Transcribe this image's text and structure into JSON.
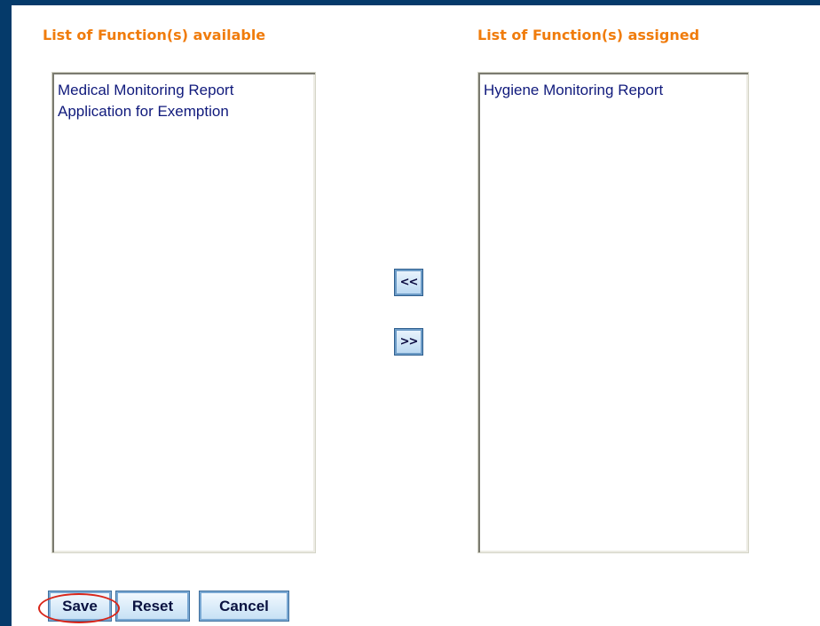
{
  "assignment": {
    "available_heading": "List of Function(s) available",
    "assigned_heading": "List of Function(s) assigned",
    "available_items": [
      "Medical Monitoring Report",
      "Application for Exemption"
    ],
    "assigned_items": [
      "Hygiene Monitoring Report"
    ],
    "remove_label": "<<",
    "add_label": ">>"
  },
  "actions": {
    "save_label": "Save",
    "reset_label": "Reset",
    "cancel_label": "Cancel"
  },
  "colors": {
    "frame": "#053a6a",
    "heading": "#f07c0c",
    "list_text": "#101a7c",
    "highlight": "#d8261a"
  }
}
